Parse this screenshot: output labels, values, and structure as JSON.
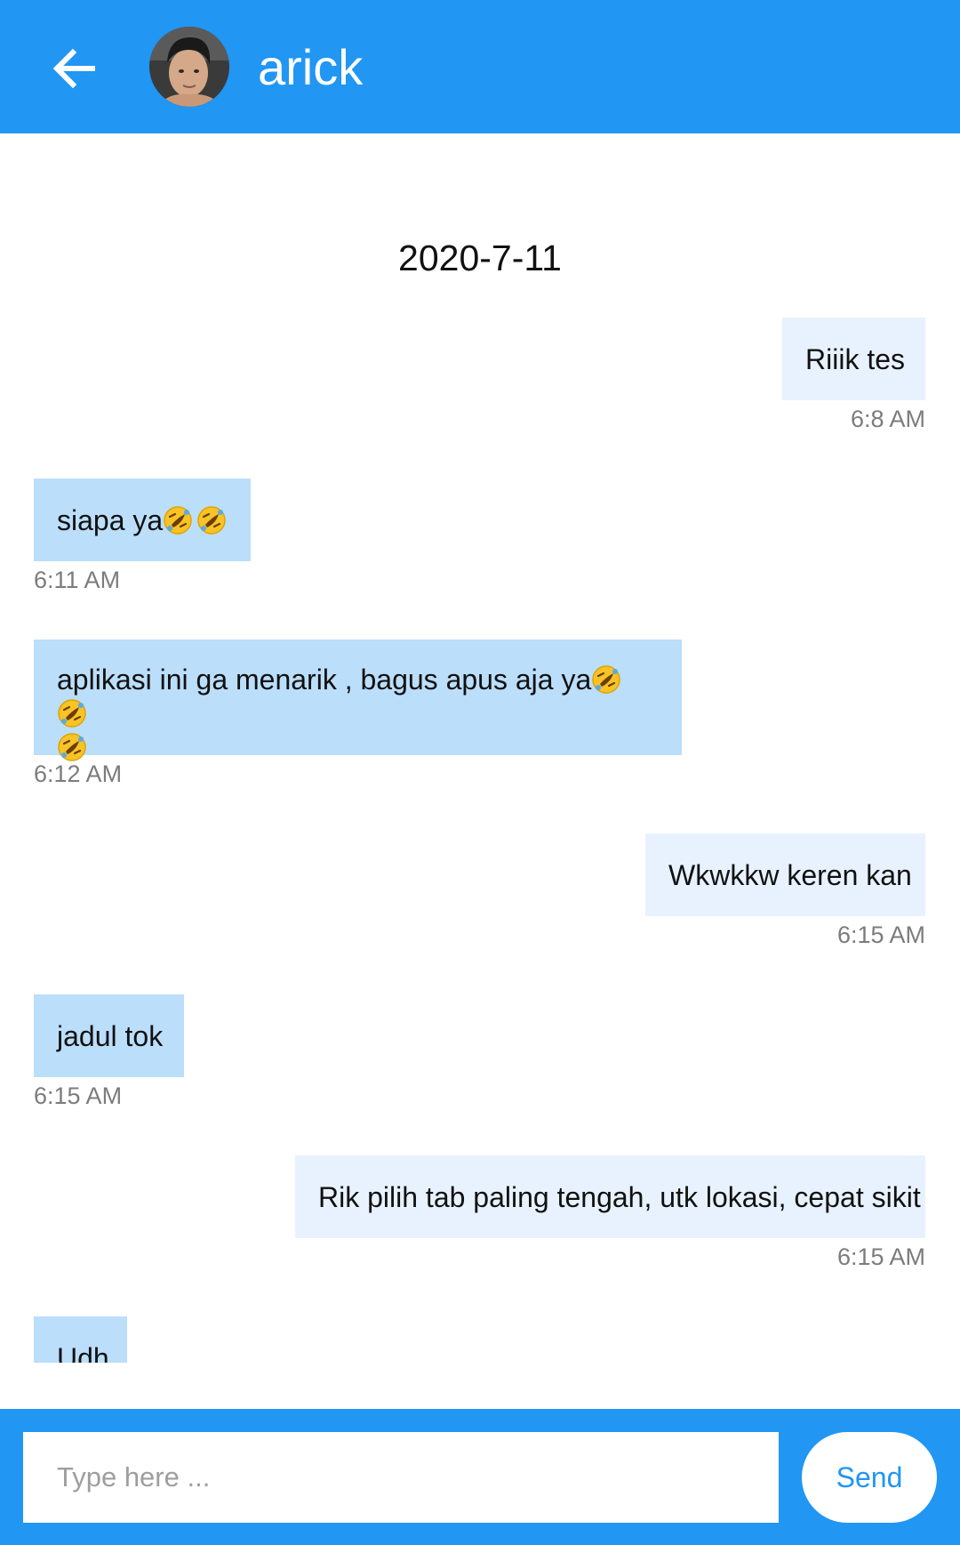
{
  "header": {
    "back_icon": "arrow-left-icon",
    "contact_name": "arick",
    "avatar_icon": "contact-avatar-photo"
  },
  "chat": {
    "date_separator": "2020-7-11",
    "messages": [
      {
        "direction": "outgoing",
        "text": "Riiik tes",
        "emoji_count": 0,
        "time": "6:8 AM"
      },
      {
        "direction": "incoming",
        "text": "siapa ya",
        "emoji": "rolling-on-the-floor-laughing-emoji",
        "emoji_count": 2,
        "time": "6:11 AM"
      },
      {
        "direction": "incoming",
        "text": "aplikasi ini ga menarik , bagus apus aja ya",
        "emoji": "rolling-on-the-floor-laughing-emoji",
        "emoji_count": 3,
        "time": "6:12 AM"
      },
      {
        "direction": "outgoing",
        "text": "Wkwkkw keren kan",
        "emoji_count": 0,
        "time": "6:15 AM"
      },
      {
        "direction": "incoming",
        "text": "jadul tok",
        "emoji_count": 0,
        "time": "6:15 AM"
      },
      {
        "direction": "outgoing",
        "text": "Rik pilih tab paling tengah, utk lokasi, cepat sikit",
        "emoji_count": 0,
        "time": "6:15 AM"
      },
      {
        "direction": "incoming",
        "text": "Udh",
        "emoji_count": 0,
        "time": ""
      }
    ]
  },
  "composer": {
    "placeholder": "Type here ...",
    "value": "",
    "send_label": "Send"
  },
  "colors": {
    "brand_blue": "#2196f3",
    "incoming_bubble": "#bbdefb",
    "outgoing_bubble": "#e8f2fe",
    "timestamp": "#7c7c7c"
  }
}
